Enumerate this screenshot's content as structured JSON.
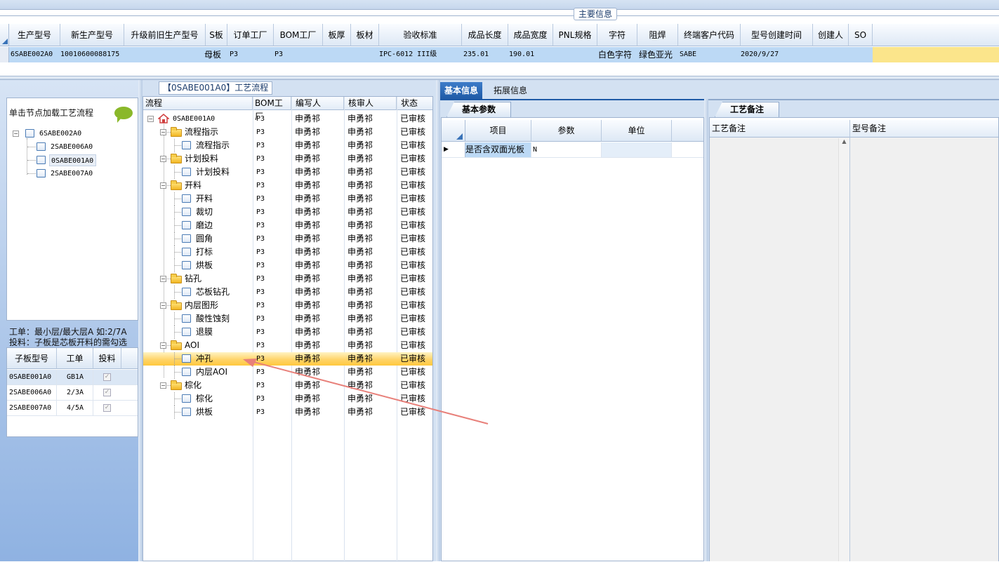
{
  "main_info": {
    "legend": "主要信息",
    "columns": [
      "生产型号",
      "新生产型号",
      "升级前旧生产型号",
      "S板",
      "订单工厂",
      "BOM工厂",
      "板厚",
      "板材",
      "验收标准",
      "成品长度",
      "成品宽度",
      "PNL规格",
      "字符",
      "阻焊",
      "终端客户代码",
      "型号创建时间",
      "创建人",
      "SO"
    ],
    "row": {
      "prod_model": "6SABE002A0",
      "new_model": "10010600088175",
      "s_board": "母板",
      "order_factory": "P3",
      "bom_factory": "P3",
      "accept_std": "IPC-6012 III级",
      "length": "235.01",
      "width": "190.01",
      "char": "白色字符",
      "solder": "绿色亚光",
      "end_customer": "SABE",
      "create_time": "2020/9/27"
    }
  },
  "left_panel": {
    "hint": "单击节点加载工艺流程",
    "tree_root": "6SABE002A0",
    "tree_children": [
      "2SABE006A0",
      "0SABE001A0",
      "2SABE007A0"
    ],
    "note_line1": "工单：最小层/最大层A 如:2/7A",
    "note_line2": "投料：子板是芯板开料的需勾选",
    "subgrid_headers": [
      "子板型号",
      "工单",
      "投料"
    ],
    "subgrid_rows": [
      {
        "model": "0SABE001A0",
        "order": "GB1A"
      },
      {
        "model": "2SABE006A0",
        "order": "2/3A"
      },
      {
        "model": "2SABE007A0",
        "order": "4/5A"
      }
    ]
  },
  "process": {
    "title": "【0SABE001A0】工艺流程",
    "headers": [
      "流程",
      "BOM工厂",
      "编写人",
      "核审人",
      "状态"
    ],
    "root": "0SABE001A0",
    "factory": "P3",
    "writer": "申勇祁",
    "reviewer": "申勇祁",
    "status": "已审核",
    "rows": [
      {
        "name": "流程指示",
        "level": 1
      },
      {
        "name": "流程指示",
        "level": 2
      },
      {
        "name": "计划投料",
        "level": 1
      },
      {
        "name": "计划投料",
        "level": 2
      },
      {
        "name": "开料",
        "level": 1
      },
      {
        "name": "开料",
        "level": 2
      },
      {
        "name": "裁切",
        "level": 2
      },
      {
        "name": "磨边",
        "level": 2
      },
      {
        "name": "圆角",
        "level": 2
      },
      {
        "name": "打标",
        "level": 2
      },
      {
        "name": "烘板",
        "level": 2
      },
      {
        "name": "钻孔",
        "level": 1
      },
      {
        "name": "芯板钻孔",
        "level": 2
      },
      {
        "name": "内层图形",
        "level": 1
      },
      {
        "name": "酸性蚀刻",
        "level": 2
      },
      {
        "name": "退膜",
        "level": 2
      },
      {
        "name": "AOI",
        "level": 1
      },
      {
        "name": "冲孔",
        "level": 2,
        "selected": true
      },
      {
        "name": "内层AOI",
        "level": 2
      },
      {
        "name": "棕化",
        "level": 1
      },
      {
        "name": "棕化",
        "level": 2
      },
      {
        "name": "烘板",
        "level": 2
      }
    ]
  },
  "right": {
    "tab_basic": "基本信息",
    "tab_ext": "拓展信息",
    "param_tab": "基本参数",
    "param_headers": [
      "项目",
      "参数",
      "单位"
    ],
    "param_row": {
      "item": "是否含双面光板",
      "value": "N"
    },
    "notes_tab": "工艺备注",
    "notes_headers": [
      "工艺备注",
      "型号备注"
    ]
  },
  "colors": {
    "selected_row": "#ffd46a",
    "header_blue": "#1f5aa6",
    "row_blue": "#bcd9f5",
    "arrow": "#e8807a"
  }
}
